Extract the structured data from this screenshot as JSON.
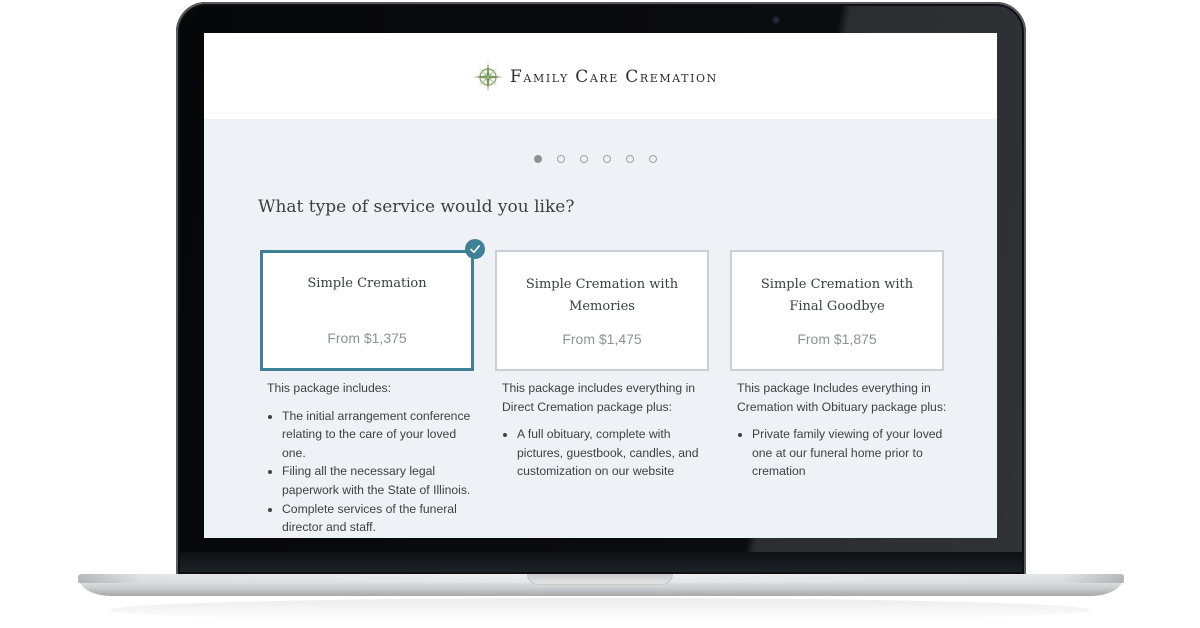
{
  "brand": {
    "logo_icon": "compass-rose-icon",
    "name_parts": [
      {
        "initial": "F",
        "rest": "amily"
      },
      {
        "initial": "C",
        "rest": "are"
      },
      {
        "initial": "C",
        "rest": "remation"
      }
    ],
    "accent_color": "#3f8196",
    "logo_icon_color": "#8aa86e"
  },
  "progress": {
    "total_steps": 6,
    "current_step": 1
  },
  "question": "What type of service would you like?",
  "packages": [
    {
      "title": "Simple Cremation",
      "price": "From $1,375",
      "selected": true,
      "intro": "This package includes:",
      "items": [
        "The initial arrangement conference relating to the care of your loved one.",
        "Filing all the necessary legal paperwork with the State of Illinois.",
        "Complete services of the funeral director and staff."
      ]
    },
    {
      "title": "Simple Cremation with Memories",
      "price": "From $1,475",
      "selected": false,
      "intro": "This package includes everything in Direct Cremation package plus:",
      "items": [
        "A full obituary, complete with pictures, guestbook, candles, and customization on our website"
      ]
    },
    {
      "title": "Simple Cremation with Final Goodbye",
      "price": "From $1,875",
      "selected": false,
      "intro": "This package Includes everything in Cremation with Obituary package plus:",
      "items": [
        "Private family viewing of your loved one at our funeral home prior to cremation"
      ]
    }
  ]
}
